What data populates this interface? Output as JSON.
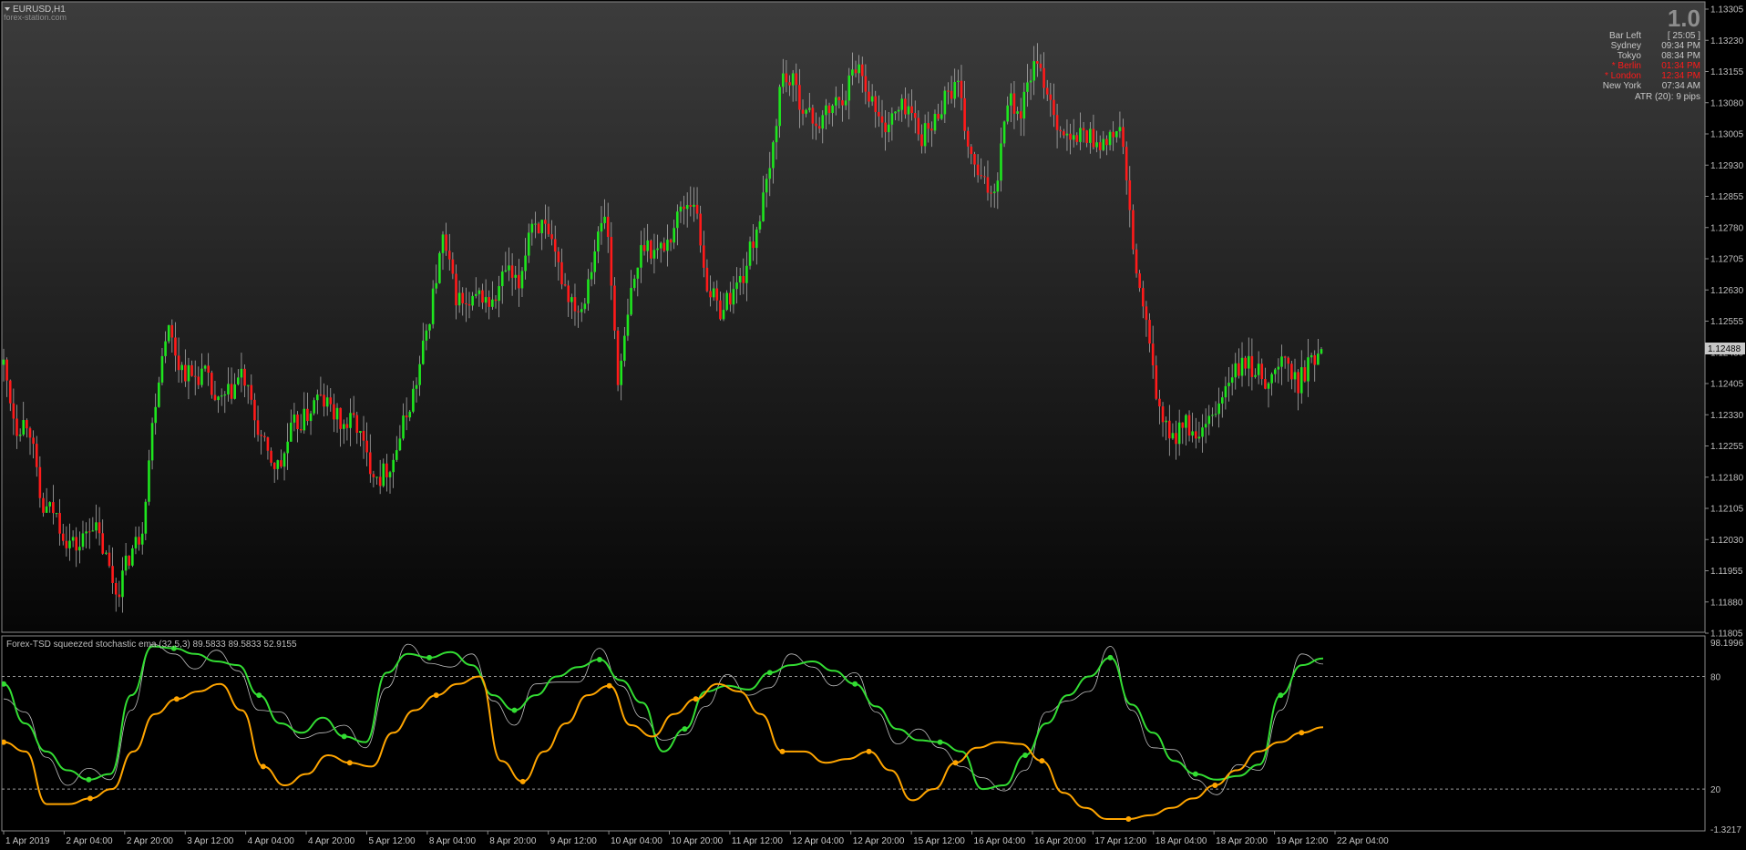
{
  "window": {
    "symbol_title": "EURUSD,H1",
    "watermark": "forex-station.com",
    "spread_value": "1.0"
  },
  "info_panel": {
    "rows": [
      {
        "label": "Bar Left",
        "value": "[ 25:05 ]",
        "color": "#c8c8c8"
      },
      {
        "label": "Sydney",
        "value": "09:34 PM",
        "color": "#c8c8c8"
      },
      {
        "label": "Tokyo",
        "value": "08:34 PM",
        "color": "#c8c8c8"
      },
      {
        "label": "* Berlin",
        "value": "01:34 PM",
        "color": "#ff1a1a"
      },
      {
        "label": "* London",
        "value": "12:34 PM",
        "color": "#ff1a1a"
      },
      {
        "label": "New York",
        "value": "07:34 AM",
        "color": "#c8c8c8"
      }
    ],
    "atr_text": "ATR (20): 9 pips"
  },
  "price_axis": {
    "labels": [
      "1.13305",
      "1.13230",
      "1.13155",
      "1.13080",
      "1.13005",
      "1.12930",
      "1.12855",
      "1.12780",
      "1.12705",
      "1.12630",
      "1.12555",
      "1.12480",
      "1.12405",
      "1.12330",
      "1.12255",
      "1.12180",
      "1.12105",
      "1.12030",
      "1.11955",
      "1.11880",
      "1.11805"
    ],
    "current_price": "1.12488"
  },
  "indicator": {
    "title": "Forex-TSD squeezed stochastic ema (32,5,3) 89.5833 89.5833 52.9155",
    "axis_labels": [
      "98.1996",
      "80",
      "20",
      "-1.3217"
    ],
    "level_high": 80,
    "level_low": 20,
    "max": 98.1996,
    "min": -1.3217
  },
  "time_axis": {
    "labels": [
      "1 Apr 2019",
      "2 Apr 04:00",
      "2 Apr 20:00",
      "3 Apr 12:00",
      "4 Apr 04:00",
      "4 Apr 20:00",
      "5 Apr 12:00",
      "8 Apr 04:00",
      "8 Apr 20:00",
      "9 Apr 12:00",
      "10 Apr 04:00",
      "10 Apr 20:00",
      "11 Apr 12:00",
      "12 Apr 04:00",
      "12 Apr 20:00",
      "15 Apr 12:00",
      "16 Apr 04:00",
      "16 Apr 20:00",
      "17 Apr 12:00",
      "18 Apr 04:00",
      "18 Apr 20:00",
      "19 Apr 12:00",
      "22 Apr 04:00"
    ]
  },
  "colors": {
    "bull_candle": "#1ee61e",
    "bear_candle": "#ff1a1a",
    "wick": "#bdbdbd",
    "osc_green": "#33dd33",
    "osc_orange": "#ffa500",
    "osc_signal": "#bfbfbf",
    "axis_text": "#c8c8c8"
  },
  "chart_data": [
    {
      "type": "candlestick",
      "symbol": "EURUSD",
      "timeframe": "H1",
      "ylim": [
        1.11805,
        1.13305
      ],
      "x_labels": [
        "1 Apr 2019",
        "2 Apr 04:00",
        "2 Apr 20:00",
        "3 Apr 12:00",
        "4 Apr 04:00",
        "4 Apr 20:00",
        "5 Apr 12:00",
        "8 Apr 04:00",
        "8 Apr 20:00",
        "9 Apr 12:00",
        "10 Apr 04:00",
        "10 Apr 20:00",
        "11 Apr 12:00",
        "12 Apr 04:00",
        "12 Apr 20:00",
        "15 Apr 12:00",
        "16 Apr 04:00",
        "16 Apr 20:00",
        "17 Apr 12:00",
        "18 Apr 04:00",
        "18 Apr 20:00",
        "19 Apr 12:00",
        "22 Apr 04:00"
      ],
      "close_path": [
        1.1245,
        1.123,
        1.1232,
        1.121,
        1.121,
        1.1203,
        1.1201,
        1.1208,
        1.12,
        1.119,
        1.1199,
        1.1205,
        1.1235,
        1.1255,
        1.1245,
        1.1242,
        1.1243,
        1.1235,
        1.1238,
        1.1243,
        1.1232,
        1.1223,
        1.122,
        1.123,
        1.1232,
        1.1237,
        1.1235,
        1.123,
        1.1232,
        1.1222,
        1.1218,
        1.1222,
        1.1232,
        1.1242,
        1.1258,
        1.1275,
        1.1262,
        1.1258,
        1.1262,
        1.1259,
        1.1268,
        1.1263,
        1.128,
        1.1278,
        1.127,
        1.1262,
        1.1258,
        1.1272,
        1.1282,
        1.124,
        1.1262,
        1.1275,
        1.1272,
        1.1275,
        1.1283,
        1.1285,
        1.1265,
        1.1258,
        1.1262,
        1.1267,
        1.1278,
        1.129,
        1.1315,
        1.1312,
        1.1305,
        1.1303,
        1.1307,
        1.131,
        1.1318,
        1.131,
        1.1302,
        1.1305,
        1.1308,
        1.13,
        1.1302,
        1.131,
        1.1312,
        1.1295,
        1.1288,
        1.1287,
        1.131,
        1.1305,
        1.1317,
        1.1313,
        1.1303,
        1.1298,
        1.1301,
        1.1299,
        1.1298,
        1.1303,
        1.1272,
        1.1255,
        1.1235,
        1.1226,
        1.1232,
        1.1226,
        1.123,
        1.1237,
        1.1243,
        1.1245,
        1.1243,
        1.1241,
        1.1247,
        1.124,
        1.1245,
        1.1249
      ],
      "last_price": 1.12488
    },
    {
      "type": "line",
      "title": "Forex-TSD squeezed stochastic ema (32,5,3) 89.5833 89.5833 52.9155",
      "ylim": [
        -1.3217,
        98.1996
      ],
      "levels": [
        80,
        20
      ],
      "x_labels": [
        "1 Apr 2019",
        "2 Apr 04:00",
        "2 Apr 20:00",
        "3 Apr 12:00",
        "4 Apr 04:00",
        "4 Apr 20:00",
        "5 Apr 12:00",
        "8 Apr 04:00",
        "8 Apr 20:00",
        "9 Apr 12:00",
        "10 Apr 04:00",
        "10 Apr 20:00",
        "11 Apr 12:00",
        "12 Apr 04:00",
        "12 Apr 20:00",
        "15 Apr 12:00",
        "16 Apr 04:00",
        "16 Apr 20:00",
        "17 Apr 12:00",
        "18 Apr 04:00",
        "18 Apr 20:00",
        "19 Apr 12:00",
        "22 Apr 04:00"
      ],
      "series": [
        {
          "values": [
            76,
            55,
            40,
            30,
            25,
            28,
            70,
            96,
            95,
            92,
            88,
            86,
            70,
            55,
            50,
            58,
            48,
            45,
            82,
            92,
            90,
            93,
            86,
            70,
            62,
            70,
            80,
            85,
            89,
            78,
            66,
            40,
            52,
            72,
            75,
            73,
            82,
            86,
            88,
            83,
            76,
            64,
            52,
            46,
            45,
            40,
            20,
            22,
            38,
            55,
            70,
            80,
            90,
            65,
            50,
            35,
            28,
            25,
            27,
            33,
            70,
            86,
            89.5833
          ]
        },
        {
          "values": [
            45,
            40,
            12,
            12,
            15,
            20,
            40,
            60,
            68,
            72,
            76,
            62,
            32,
            22,
            28,
            38,
            34,
            32,
            50,
            62,
            70,
            76,
            80,
            35,
            24,
            40,
            55,
            70,
            75,
            54,
            48,
            60,
            68,
            76,
            72,
            60,
            40,
            40,
            34,
            36,
            40,
            30,
            14,
            20,
            34,
            42,
            45,
            44,
            35,
            18,
            10,
            4,
            4,
            6,
            10,
            15,
            22,
            30,
            40,
            45,
            50,
            52.9155
          ]
        }
      ]
    }
  ]
}
